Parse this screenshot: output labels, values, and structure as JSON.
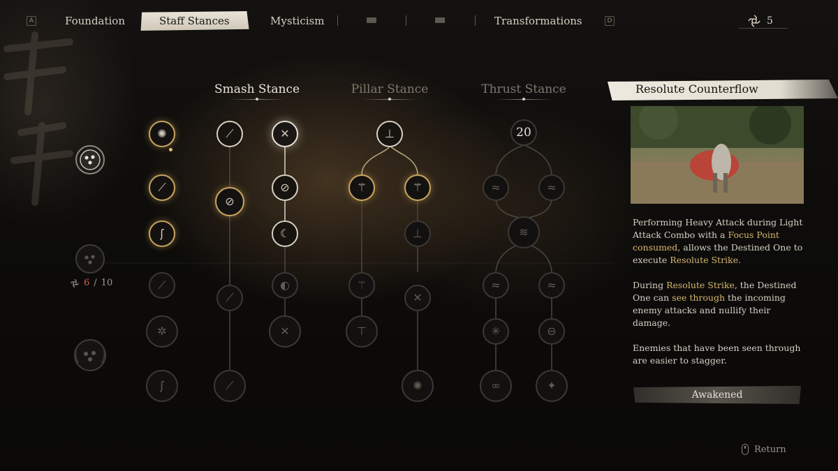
{
  "top_nav": {
    "left_key": "A",
    "right_key": "D",
    "tabs": [
      {
        "label": "Foundation",
        "active": false
      },
      {
        "label": "Staff Stances",
        "active": true
      },
      {
        "label": "Mysticism",
        "active": false
      },
      {
        "label": "",
        "locked": true
      },
      {
        "label": "",
        "locked": true
      },
      {
        "label": "Transformations",
        "active": false
      }
    ],
    "spark_points": "5"
  },
  "left_panel": {
    "spark_used": "6",
    "spark_sep": "/",
    "spark_total": "10"
  },
  "stances": {
    "smash": "Smash Stance",
    "pillar": "Pillar Stance",
    "thrust": "Thrust Stance",
    "thrust_required": "20"
  },
  "detail": {
    "title": "Resolute Counterflow",
    "p1_a": "Performing Heavy Attack during Light Attack Combo with a ",
    "p1_h1": "Focus Point consumed",
    "p1_b": ", allows the Destined One to execute ",
    "p1_h2": "Resolute Strike",
    "p1_c": ".",
    "p2_a": "During ",
    "p2_h1": "Resolute Strike",
    "p2_b": ", the Destined One can ",
    "p2_h2": "see through",
    "p2_c": " the incoming enemy attacks and nullify their damage.",
    "p3": "Enemies that have been seen through are easier to stagger.",
    "status_button": "Awakened",
    "return_label": "Return"
  },
  "colors": {
    "highlight": "#d8b872",
    "unlocked_ring": "#c8a45e",
    "spark_used": "#d36052"
  }
}
